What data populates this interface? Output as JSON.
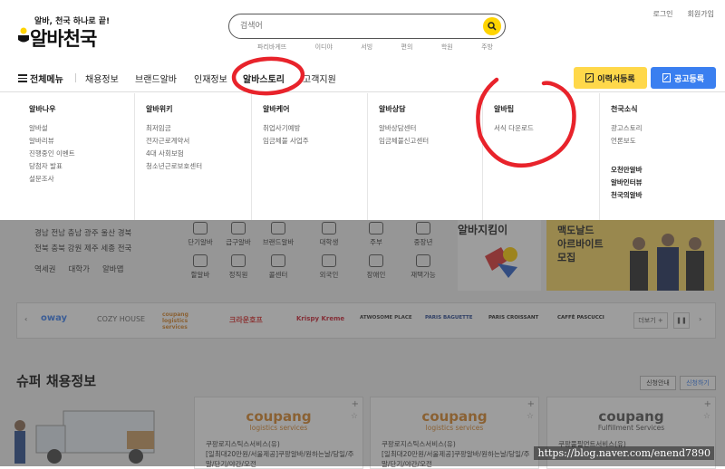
{
  "header": {
    "tagline": "알바, 천국 하나로 끝!",
    "logo": "알바천국",
    "search_placeholder": "검색어",
    "popular": [
      "파리바게뜨",
      "이디야",
      "서빙",
      "편의",
      "학원",
      "주방"
    ],
    "login": "로그인",
    "signup": "회원가입"
  },
  "nav": {
    "all_menu": "전체메뉴",
    "items": [
      "채용정보",
      "브랜드알바",
      "인재정보",
      "알바스토리",
      "고객지원"
    ],
    "resume_btn": "이력서등록",
    "post_btn": "공고등록"
  },
  "mega": [
    {
      "title": "알바나우",
      "items": [
        "알바설",
        "알바리뷰",
        "진행중인 이벤트",
        "당첨자 발표",
        "설문조사"
      ]
    },
    {
      "title": "알바위키",
      "items": [
        "최저임금",
        "전자근로계약서",
        "4대 사회보험",
        "청소년근로보호센터"
      ]
    },
    {
      "title": "알바케어",
      "items": [
        "취업사기예방",
        "임금체불 사업주"
      ]
    },
    {
      "title": "알바상담",
      "items": [
        "알바상담센터",
        "임금체불신고센터"
      ]
    },
    {
      "title": "알바팁",
      "items": [
        "서식 다운로드"
      ]
    },
    {
      "title": "천국소식",
      "items": [
        "광고스토리",
        "언론보도"
      ],
      "extra": [
        "오천만알바",
        "알바인터뷰",
        "천국의알바"
      ]
    }
  ],
  "background": {
    "regions_row1": "경남  전남  충남  광주  울산  경북",
    "regions_row2": "전북  충북  강원  제주  세종  전국",
    "links": [
      "역세권",
      "대학가",
      "알바맵"
    ],
    "services": [
      "단기알바",
      "급구알바",
      "브랜드알바",
      "할알바",
      "정직원",
      "콜센터"
    ],
    "targets": [
      "대학생",
      "주부",
      "중장년",
      "외국인",
      "장애인",
      "재택가능"
    ],
    "promo_title": "알바지킴이",
    "mc_line1": "맥도날드",
    "mc_line2": "아르바이트",
    "mc_line3": "모집",
    "brands": [
      "oway",
      "COZY HOUSE",
      "coupang logistics services",
      "크라운호프",
      "Krispy Kreme",
      "ATWOSOME PLACE",
      "PARIS BAGUETTE",
      "PARIS CROISSANT",
      "CAFFÈ PASCUCCI"
    ],
    "more": "더보기",
    "super_title": "슈퍼 채용정보",
    "super_btn1": "신청안내",
    "super_btn2": "신청하기",
    "cards": [
      {
        "logo": "coupang",
        "sub": "logistics services",
        "company": "쿠팡로지스틱스서비스(유)",
        "desc": "[일최대20만원/서울제공]쿠팡알바/원하는날/당일/주말/단기/야간/오전"
      },
      {
        "logo": "coupang",
        "sub": "logistics services",
        "company": "쿠팡로지스틱스서비스(유)",
        "desc": "[일최대20만원/서울제공]쿠팡알바/원하는날/당일/주말/단기/야간/오전"
      },
      {
        "logo": "coupang",
        "sub": "Fulfillment Services",
        "company": "쿠팡풀필먼트서비스(유)",
        "desc": ""
      }
    ]
  },
  "watermark": "https://blog.naver.com/enend7890",
  "colors": {
    "accent_yellow": "#ffd400",
    "resume_yellow": "#ffd84a",
    "post_blue": "#3a7ff0",
    "annotation_red": "#e8232b"
  }
}
